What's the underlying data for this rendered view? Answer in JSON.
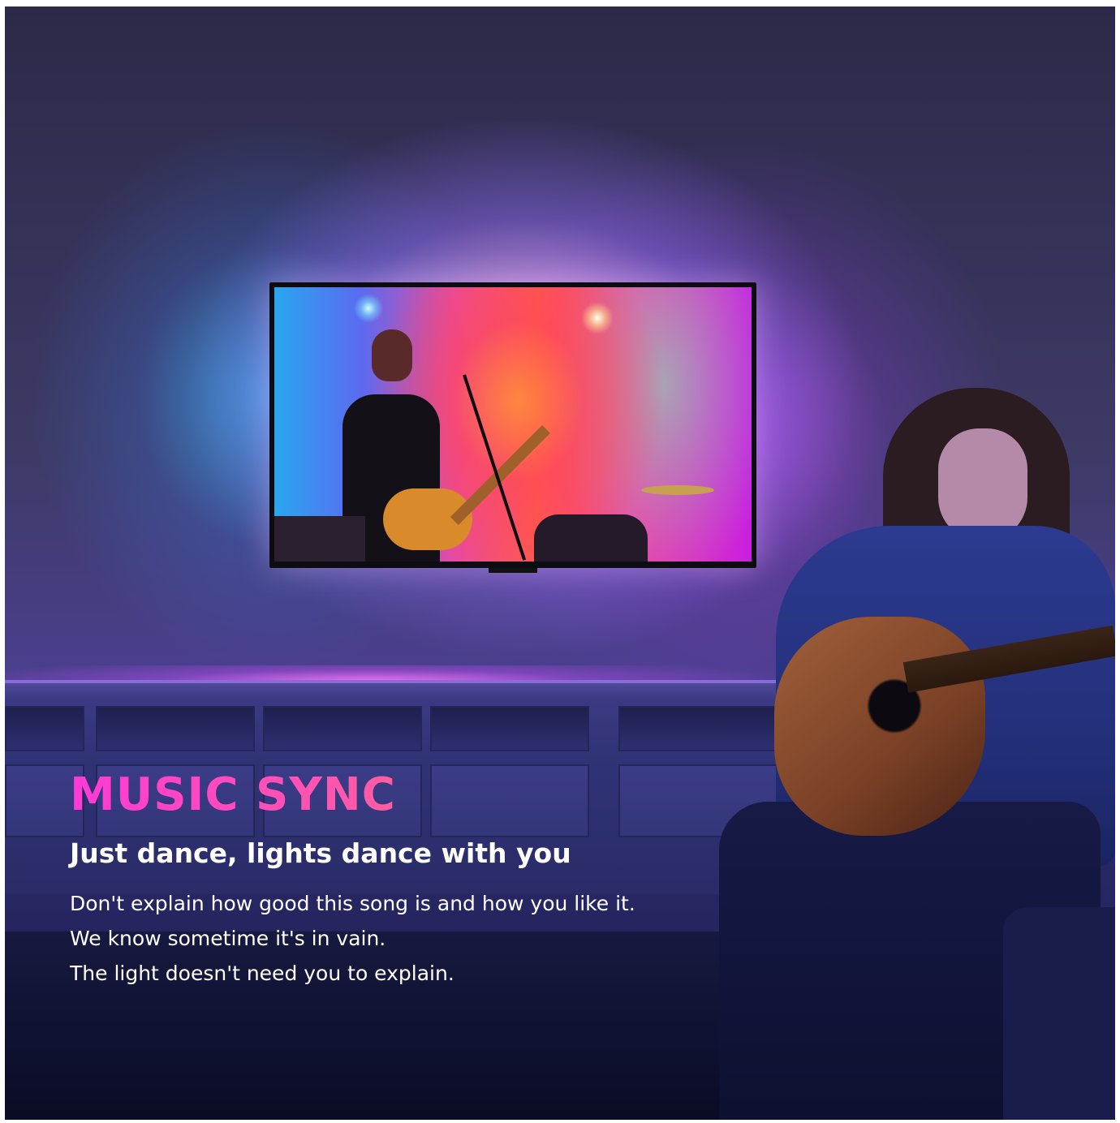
{
  "headline": "MUSIC SYNC",
  "subheadline": "Just dance, lights dance with you",
  "body_lines": [
    "Don't explain how good this song is and how you like it.",
    "We know sometime it's in vain.",
    "The light doesn't need you to explain."
  ],
  "colors": {
    "headline_gradient_start": "#ff3ad6",
    "headline_gradient_end": "#ff9a3a",
    "text": "#ffffff",
    "wall_glow": "#b06cff"
  }
}
